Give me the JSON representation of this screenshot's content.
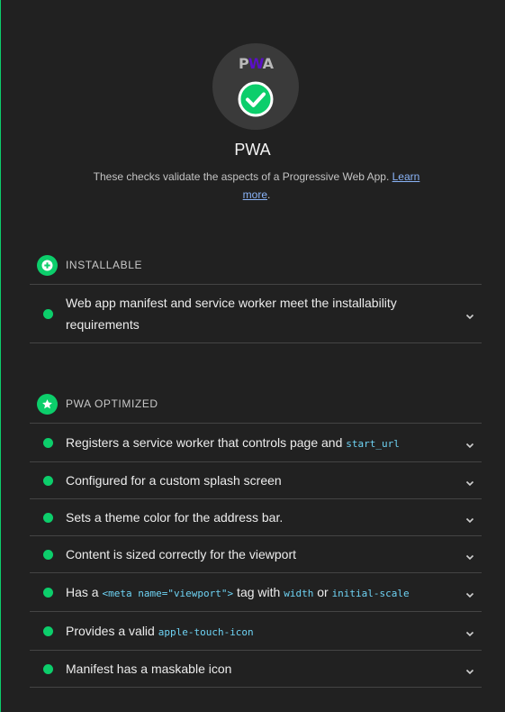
{
  "category": {
    "logo": {
      "p": "P",
      "w": "W",
      "a": "A"
    },
    "title": "PWA",
    "description": "These checks validate the aspects of a Progressive Web App.",
    "learn_more": "Learn more",
    "period": "."
  },
  "groups": [
    {
      "title": "INSTALLABLE",
      "icon": "plus-circle-icon",
      "audits": [
        {
          "parts": [
            "Web app manifest and service worker meet the installability requirements"
          ]
        }
      ]
    },
    {
      "title": "PWA OPTIMIZED",
      "icon": "star-icon",
      "audits": [
        {
          "parts": [
            "Registers a service worker that controls page and ",
            "start_url"
          ]
        },
        {
          "parts": [
            "Configured for a custom splash screen"
          ]
        },
        {
          "parts": [
            "Sets a theme color for the address bar."
          ]
        },
        {
          "parts": [
            "Content is sized correctly for the viewport"
          ]
        },
        {
          "parts": [
            "Has a ",
            "<meta name=\"viewport\">",
            " tag with ",
            "width",
            " or ",
            "initial-scale"
          ]
        },
        {
          "parts": [
            "Provides a valid ",
            "apple-touch-icon"
          ]
        },
        {
          "parts": [
            "Manifest has a maskable icon"
          ]
        }
      ]
    }
  ],
  "colors": {
    "pass": "#0cce6b",
    "link": "#8ab4f8",
    "code": "#6ed3f4",
    "background": "#212121"
  }
}
